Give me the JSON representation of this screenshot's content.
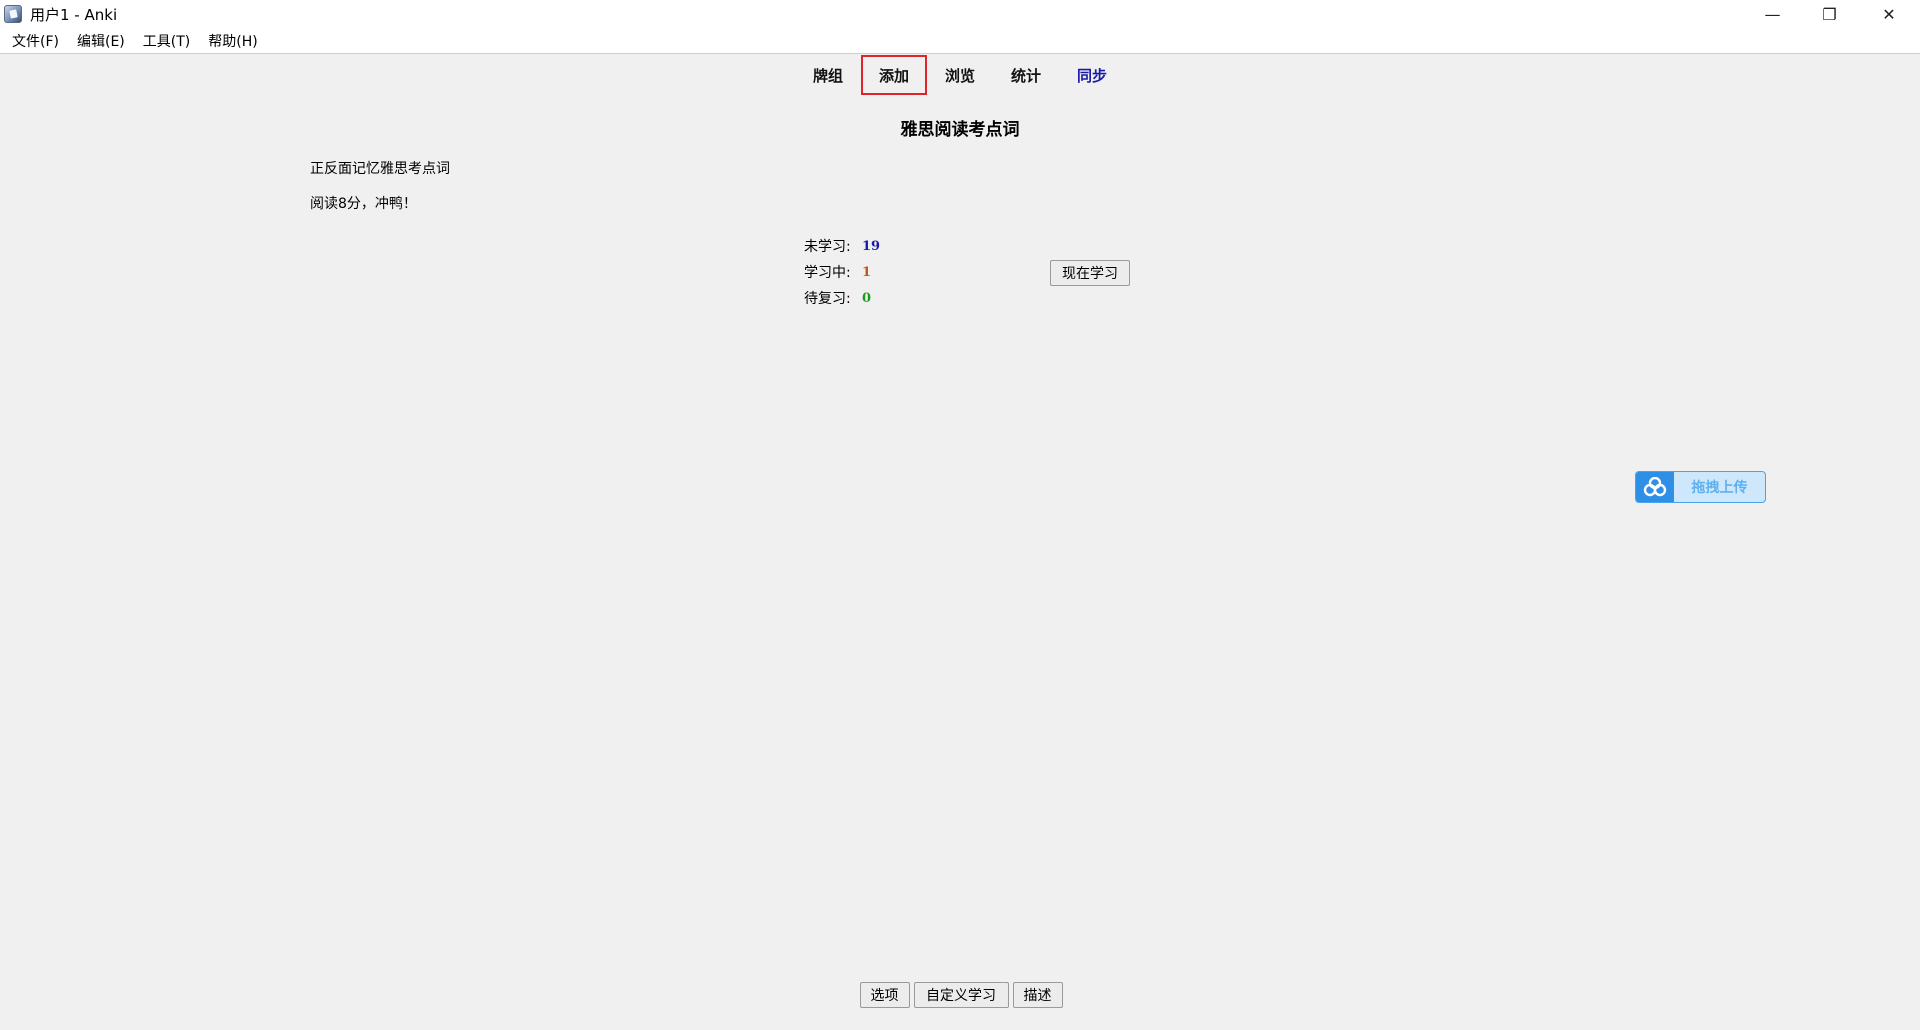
{
  "window": {
    "title": "用户1 - Anki",
    "minimize": "—",
    "maximize": "❐",
    "close": "✕"
  },
  "menu": {
    "items": [
      "文件(F)",
      "编辑(E)",
      "工具(T)",
      "帮助(H)"
    ]
  },
  "toolbar": {
    "decks": "牌组",
    "add": "添加",
    "browse": "浏览",
    "stats": "统计",
    "sync": "同步"
  },
  "deck": {
    "title": "雅思阅读考点词",
    "description_line1": "正反面记忆雅思考点词",
    "description_line2": "阅读8分，冲鸭！"
  },
  "stats": {
    "new_label": "未学习:",
    "new_count": "19",
    "learning_label": "学习中:",
    "learning_count": "1",
    "review_label": "待复习:",
    "review_count": "0"
  },
  "study_button": "现在学习",
  "upload_widget": {
    "icon": "cloud-icon",
    "label": "拖拽上传"
  },
  "bottom_buttons": {
    "options": "选项",
    "custom_study": "自定义学习",
    "description": "描述"
  },
  "colors": {
    "new": "#1a1aa8",
    "learning": "#c35617",
    "review": "#1a9a1a",
    "highlight_box": "#e0252a",
    "sync_link": "#1a1aa8"
  }
}
